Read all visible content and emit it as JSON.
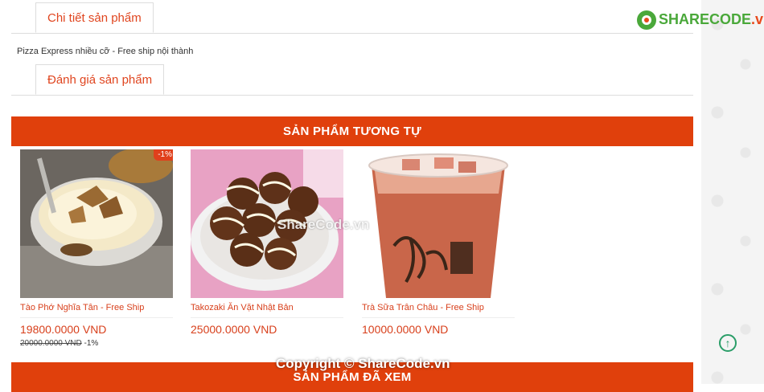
{
  "tabs": {
    "details": "Chi tiết sản phẩm",
    "reviews": "Đánh giá sản phẩm"
  },
  "description": "Pizza Express nhiều cỡ - Free ship nội thành",
  "sections": {
    "similar": "SẢN PHẨM TƯƠNG TỰ",
    "viewed": "SẢN PHẨM ĐÃ XEM"
  },
  "products": [
    {
      "name": "Tào Phớ Nghĩa Tân - Free Ship",
      "price": "19800.0000 VND",
      "old_price": "20000.0000 VND",
      "discount_text": "-1%",
      "badge": "-1%"
    },
    {
      "name": "Takozaki Ăn Vặt Nhật Bản",
      "price": "25000.0000 VND"
    },
    {
      "name": "Trà Sữa Trân Châu - Free Ship",
      "price": "10000.0000 VND"
    }
  ],
  "logo": {
    "brand_main": "SHARECODE",
    "brand_suffix": ".vn"
  },
  "watermark": {
    "center": "ShareCode.vn",
    "footer": "Copyright © ShareCode.vn"
  },
  "colors": {
    "accent": "#e0400c",
    "link": "#d8401c",
    "scroll_top": "#2a9d68"
  },
  "icons": {
    "scroll_top": "arrow-up-circle-icon"
  }
}
